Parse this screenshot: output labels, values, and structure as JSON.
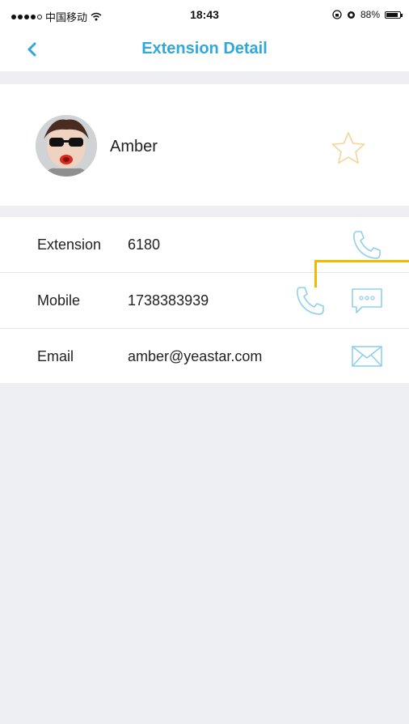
{
  "status_bar": {
    "carrier": "中国移动",
    "time": "18:43",
    "battery": "88%",
    "battery_level": 0.88
  },
  "nav": {
    "title": "Extension Detail",
    "back_icon": "chevron-left-icon"
  },
  "profile": {
    "name": "Amber",
    "favorite_icon": "star-outline-icon"
  },
  "details": [
    {
      "label": "Extension",
      "value": "6180",
      "actions": [
        "phone-icon"
      ]
    },
    {
      "label": "Mobile",
      "value": "1738383939",
      "actions": [
        "phone-icon",
        "message-icon"
      ]
    },
    {
      "label": "Email",
      "value": "amber@yeastar.com",
      "actions": [
        "mail-icon"
      ]
    }
  ],
  "colors": {
    "accent": "#2fa8dc",
    "icon_light": "#8fd0ec",
    "background": "#eeeff3",
    "highlight": "#f5b800",
    "star": "#f6d49a"
  }
}
